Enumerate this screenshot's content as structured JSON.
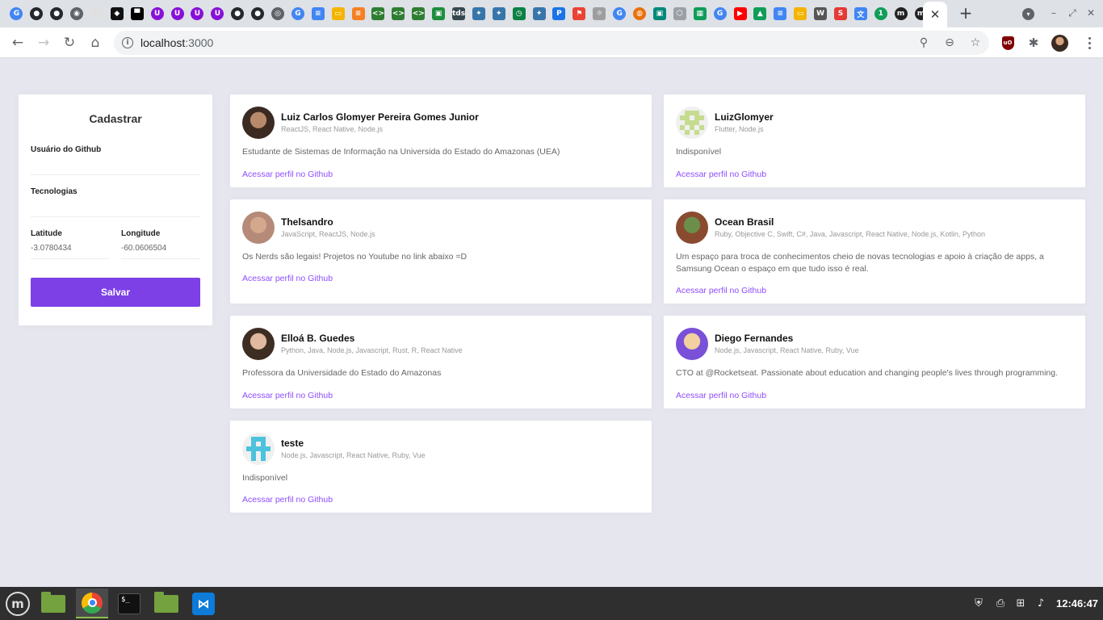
{
  "browser": {
    "tab_favicons": [
      {
        "icon": "google-icon",
        "glyph": "G",
        "color": "#4285f4",
        "round": true
      },
      {
        "icon": "github-icon",
        "glyph": "●",
        "color": "#24292e",
        "round": true
      },
      {
        "icon": "github-icon",
        "glyph": "●",
        "color": "#24292e",
        "round": true
      },
      {
        "icon": "globe-icon",
        "glyph": "◉",
        "color": "#5f6368",
        "round": true
      },
      {
        "icon": "circle-icon",
        "glyph": "",
        "color": "#e0e0e0",
        "round": true
      },
      {
        "icon": "codepen-icon",
        "glyph": "◆",
        "color": "#111111",
        "round": false
      },
      {
        "icon": "block-icon",
        "glyph": "▀",
        "color": "#000000",
        "round": false
      },
      {
        "icon": "udemy-icon",
        "glyph": "U",
        "color": "#8710d8",
        "round": true
      },
      {
        "icon": "udemy-icon",
        "glyph": "U",
        "color": "#8710d8",
        "round": true
      },
      {
        "icon": "udemy-icon",
        "glyph": "U",
        "color": "#8710d8",
        "round": true
      },
      {
        "icon": "udemy-icon",
        "glyph": "U",
        "color": "#8710d8",
        "round": true
      },
      {
        "icon": "github-icon",
        "glyph": "●",
        "color": "#24292e",
        "round": true
      },
      {
        "icon": "github-icon",
        "glyph": "●",
        "color": "#24292e",
        "round": true
      },
      {
        "icon": "chrome-icon",
        "glyph": "◎",
        "color": "#5f6368",
        "round": true
      },
      {
        "icon": "google-icon",
        "glyph": "G",
        "color": "#4285f4",
        "round": true
      },
      {
        "icon": "google-docs-icon",
        "glyph": "≡",
        "color": "#4285f4",
        "round": false
      },
      {
        "icon": "google-slides-icon",
        "glyph": "▭",
        "color": "#f4b400",
        "round": false
      },
      {
        "icon": "stackoverflow-icon",
        "glyph": "≡",
        "color": "#f48024",
        "round": false
      },
      {
        "icon": "code-icon",
        "glyph": "<>",
        "color": "#2e7d32",
        "round": false
      },
      {
        "icon": "code-icon",
        "glyph": "<>",
        "color": "#2e7d32",
        "round": false
      },
      {
        "icon": "code-icon",
        "glyph": "<>",
        "color": "#2e7d32",
        "round": false
      },
      {
        "icon": "classroom-icon",
        "glyph": "▣",
        "color": "#1e8e3e",
        "round": false
      },
      {
        "icon": "tds-icon",
        "glyph": "tds",
        "color": "#37474f",
        "round": false
      },
      {
        "icon": "python-icon",
        "glyph": "✦",
        "color": "#3776ab",
        "round": false
      },
      {
        "icon": "python-icon",
        "glyph": "✦",
        "color": "#3776ab",
        "round": false
      },
      {
        "icon": "timer-icon",
        "glyph": "◷",
        "color": "#0b8043",
        "round": false
      },
      {
        "icon": "python-icon",
        "glyph": "✦",
        "color": "#3776ab",
        "round": false
      },
      {
        "icon": "parking-icon",
        "glyph": "P",
        "color": "#1a73e8",
        "round": false
      },
      {
        "icon": "maps-icon",
        "glyph": "⚑",
        "color": "#ea4335",
        "round": false
      },
      {
        "icon": "lightbulb-icon",
        "glyph": "☼",
        "color": "#9e9e9e",
        "round": false
      },
      {
        "icon": "google-icon",
        "glyph": "G",
        "color": "#4285f4",
        "round": true
      },
      {
        "icon": "rocket-icon",
        "glyph": "◍",
        "color": "#e8710a",
        "round": true
      },
      {
        "icon": "contacts-icon",
        "glyph": "▣",
        "color": "#00897b",
        "round": false
      },
      {
        "icon": "shield-icon",
        "glyph": "⬡",
        "color": "#9aa0a6",
        "round": false
      },
      {
        "icon": "sheet-icon",
        "glyph": "▦",
        "color": "#0f9d58",
        "round": false
      },
      {
        "icon": "google-icon",
        "glyph": "G",
        "color": "#4285f4",
        "round": true
      },
      {
        "icon": "youtube-icon",
        "glyph": "▶",
        "color": "#ff0000",
        "round": false
      },
      {
        "icon": "google-drive-icon",
        "glyph": "▲",
        "color": "#0f9d58",
        "round": false
      },
      {
        "icon": "google-docs-icon",
        "glyph": "≡",
        "color": "#4285f4",
        "round": false
      },
      {
        "icon": "google-slides-icon",
        "glyph": "▭",
        "color": "#f4b400",
        "round": false
      },
      {
        "icon": "wikipedia-icon",
        "glyph": "W",
        "color": "#555555",
        "round": false
      },
      {
        "icon": "s-icon",
        "glyph": "S",
        "color": "#e53935",
        "round": false
      },
      {
        "icon": "translate-icon",
        "glyph": "文",
        "color": "#4285f4",
        "round": false
      },
      {
        "icon": "one-icon",
        "glyph": "1",
        "color": "#0f9d58",
        "round": true
      },
      {
        "icon": "medium-icon",
        "glyph": "m",
        "color": "#222222",
        "round": true
      },
      {
        "icon": "medium-icon",
        "glyph": "m",
        "color": "#222222",
        "round": true
      }
    ],
    "active_tab_close": "✕",
    "new_tab": "+",
    "window_controls": [
      "–",
      "⤢",
      "✕"
    ],
    "url_host": "localhost",
    "url_port": ":3000"
  },
  "form": {
    "title": "Cadastrar",
    "github_user_label": "Usuário do Github",
    "github_user_value": "",
    "techs_label": "Tecnologias",
    "techs_value": "",
    "latitude_label": "Latitude",
    "latitude_value": "-3.0780434",
    "longitude_label": "Longitude",
    "longitude_value": "-60.0606504",
    "submit_label": "Salvar"
  },
  "devs": [
    {
      "name": "Luiz Carlos Glomyer Pereira Gomes Junior",
      "techs": "ReactJS, React Native, Node.js",
      "bio": "Estudante de Sistemas de Informação na Universida do Estado do Amazonas (UEA)",
      "link": "Acessar perfil no Github",
      "avatar": {
        "kind": "photo",
        "skin": "#b8896a",
        "bg": "#3b2a22"
      }
    },
    {
      "name": "LuizGlomyer",
      "techs": "Flutter, Node.js",
      "bio": "Indisponível",
      "link": "Acessar perfil no Github",
      "avatar": {
        "kind": "identicon",
        "color": "#c5dc8f",
        "cells": [
          0,
          1,
          1,
          1,
          0,
          1,
          1,
          0,
          1,
          1,
          0,
          1,
          1,
          1,
          0,
          1,
          0,
          1,
          0,
          1,
          0,
          1,
          0,
          1,
          0
        ]
      }
    },
    {
      "name": "Thelsandro",
      "techs": "JavaScript, ReactJS, Node.js",
      "bio": "Os Nerds são legais! Projetos no Youtube no link abaixo =D",
      "link": "Acessar perfil no Github",
      "avatar": {
        "kind": "photo",
        "skin": "#d4a88c",
        "bg": "#b58a78"
      }
    },
    {
      "name": "Ocean Brasil",
      "techs": "Ruby, Objective C, Swift, C#, Java, Javascript, React Native, Node.js, Kotlin, Python",
      "bio": "Um espaço para troca de conhecimentos cheio de novas tecnologias e apoio à criação de apps, a Samsung Ocean o espaço em que tudo isso é real.",
      "link": "Acessar perfil no Github",
      "avatar": {
        "kind": "photo",
        "skin": "#6b8f4a",
        "bg": "#8a4a30"
      }
    },
    {
      "name": "Elloá B. Guedes",
      "techs": "Python, Java, Node.js, Javascript, Rust, R, React Native",
      "bio": "Professora da Universidade do Estado do Amazonas",
      "link": "Acessar perfil no Github",
      "avatar": {
        "kind": "photo",
        "skin": "#e0b9a0",
        "bg": "#3e2d22"
      }
    },
    {
      "name": "Diego Fernandes",
      "techs": "Node.js, Javascript, React Native, Ruby, Vue",
      "bio": "CTO at @Rocketseat. Passionate about education and changing people's lives through programming.",
      "link": "Acessar perfil no Github",
      "avatar": {
        "kind": "photo",
        "skin": "#f2d0a0",
        "bg": "#7a50d8"
      }
    },
    {
      "name": "teste",
      "techs": "Node.js, Javascript, React Native, Ruby, Vue",
      "bio": "Indisponível",
      "link": "Acessar perfil no Github",
      "avatar": {
        "kind": "identicon",
        "color": "#4dc2dd",
        "cells": [
          0,
          1,
          1,
          1,
          0,
          0,
          1,
          0,
          1,
          0,
          1,
          1,
          1,
          1,
          1,
          0,
          1,
          0,
          1,
          0,
          0,
          1,
          0,
          1,
          0
        ]
      }
    }
  ],
  "taskbar": {
    "apps": [
      "mint-menu-icon",
      "file-manager-icon",
      "chrome-icon",
      "terminal-icon",
      "files-icon",
      "vscode-icon"
    ],
    "terminal_prompt": "$_",
    "clock": "12:46:47"
  }
}
